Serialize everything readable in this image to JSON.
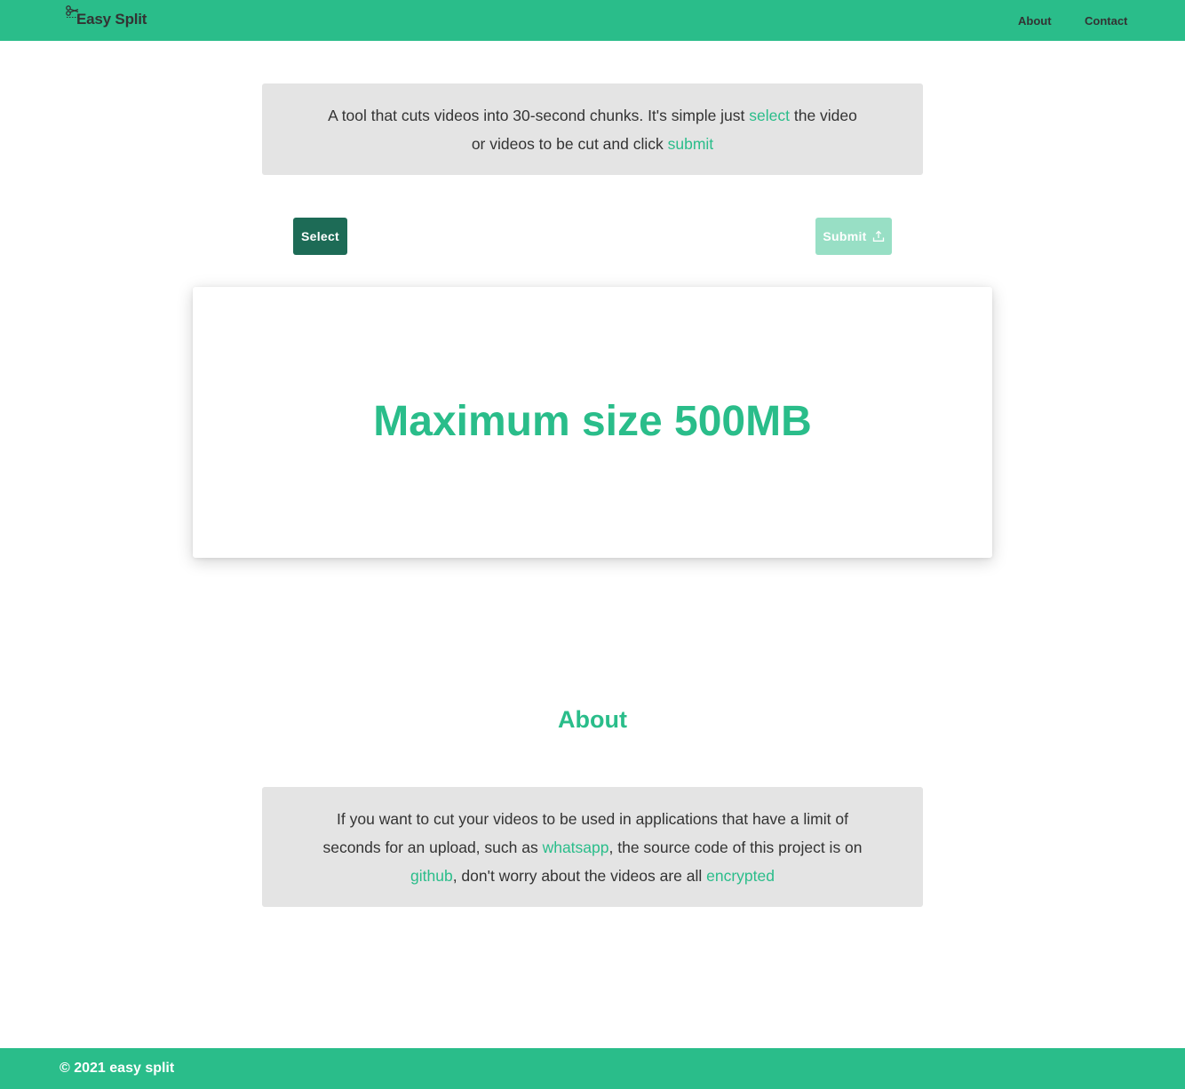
{
  "header": {
    "brand_icon": "scissors-icon",
    "brand_text": "Easy Split",
    "nav": [
      {
        "label": "About"
      },
      {
        "label": "Contact"
      }
    ],
    "background_color": "#2abd8a"
  },
  "intro": {
    "text_before_select": "A tool that cuts videos into 30-second chunks. It's simple just ",
    "select_word": "select",
    "text_middle": " the video or videos to be cut and click ",
    "submit_word": "submit"
  },
  "actions": {
    "select_label": "Select",
    "submit_label": "Submit",
    "submit_icon": "upload-icon"
  },
  "dropzone": {
    "title": "Maximum size 500MB"
  },
  "about": {
    "heading": "About",
    "text_1": "If you want to cut your videos to be used in applications that have a limit of seconds for an upload, such as ",
    "link_whatsapp": "whatsapp",
    "text_2": ", the source code of this project is on ",
    "link_github": "github",
    "text_3": ", don't worry about the videos are all ",
    "link_encrypted": "encrypted"
  },
  "footer": {
    "text": "© 2021 easy split"
  },
  "colors": {
    "accent": "#2abd8a",
    "select_button": "#1d6b56",
    "submit_button_disabled": "#98dfc5",
    "info_box": "#e4e4e4"
  }
}
